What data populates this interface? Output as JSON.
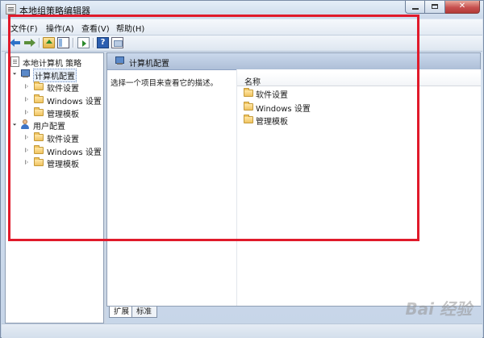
{
  "window": {
    "title": "本地组策略编辑器"
  },
  "menubar": {
    "items": [
      "文件(F)",
      "操作(A)",
      "查看(V)",
      "帮助(H)"
    ]
  },
  "toolbar": {
    "icons": [
      "back-arrow-icon",
      "forward-arrow-icon",
      "up-folder-icon",
      "show-hide-tree-icon",
      "export-list-icon",
      "help-icon",
      "properties-icon"
    ],
    "help_glyph": "?"
  },
  "tree": {
    "root": "本地计算机 策略",
    "computer": {
      "label": "计算机配置",
      "children": [
        "软件设置",
        "Windows 设置",
        "管理模板"
      ]
    },
    "user": {
      "label": "用户配置",
      "children": [
        "软件设置",
        "Windows 设置",
        "管理模板"
      ]
    }
  },
  "right_pane": {
    "header": "计算机配置",
    "description": "选择一个项目来查看它的描述。",
    "column_name": "名称",
    "rows": [
      "软件设置",
      "Windows 设置",
      "管理模板"
    ]
  },
  "tabs": [
    "扩展",
    "标准"
  ],
  "watermark": "Bai 经验",
  "colors": {
    "highlight": "#e01a2b",
    "header_blue": "#aebfd8"
  }
}
